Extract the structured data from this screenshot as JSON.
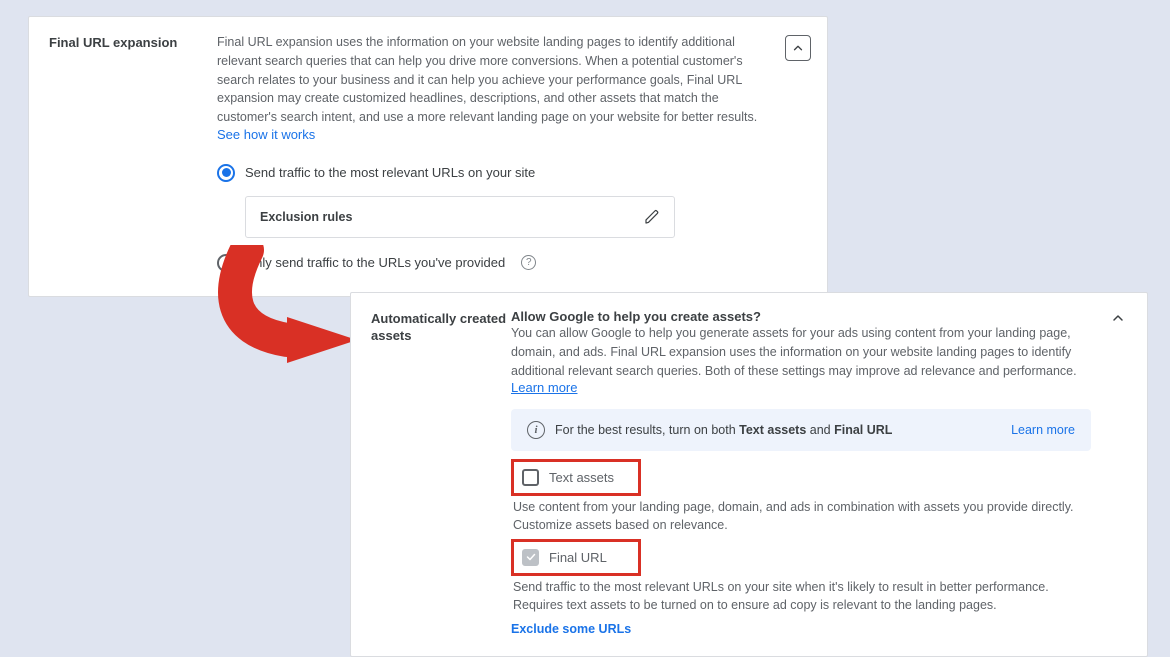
{
  "panel1": {
    "title": "Final URL expansion",
    "description": "Final URL expansion uses the information on your website landing pages to identify additional relevant search queries that can help you drive more conversions. When a potential customer's search relates to your business and it can help you achieve your performance goals, Final URL expansion may create customized headlines, descriptions, and other assets that match the customer's search intent, and use a more relevant landing page on your website for better results. ",
    "see_how": "See how it works",
    "radio_relevant": "Send traffic to the most relevant URLs on your site",
    "exclusion_label": "Exclusion rules",
    "radio_only": "Only send traffic to the URLs you've provided"
  },
  "panel2": {
    "title": "Automatically created assets",
    "question": "Allow Google to help you create assets?",
    "description": "You can allow Google to help you generate assets for your ads using content from your landing page, domain, and ads. Final URL expansion uses the information on your website landing pages to identify additional relevant search queries. Both of these settings may improve ad relevance and performance. ",
    "learn_more": "Learn more",
    "banner_prefix": "For the best results, turn on both ",
    "banner_b1": "Text assets",
    "banner_mid": " and ",
    "banner_b2": "Final URL",
    "banner_learn_more": "Learn more",
    "opt_text_label": "Text assets",
    "opt_text_desc": "Use content from your landing page, domain, and ads in combination with assets you provide directly. Customize assets based on relevance.",
    "opt_final_label": "Final URL",
    "opt_final_desc": "Send traffic to the most relevant URLs on your site when it's likely to result in better performance. Requires text assets to be turned on to ensure ad copy is relevant to the landing pages.",
    "exclude_link": "Exclude some URLs"
  }
}
